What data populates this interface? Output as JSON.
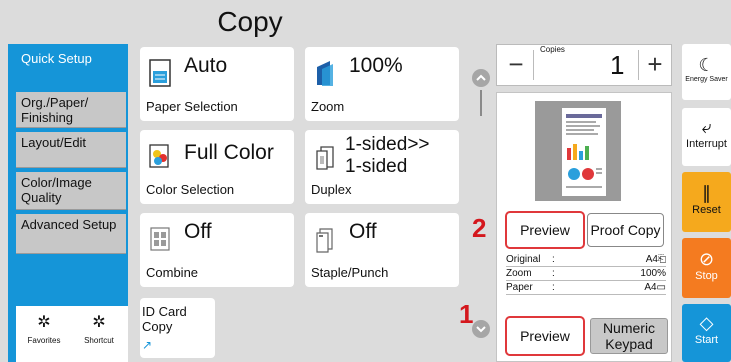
{
  "title": "Copy",
  "sidebar": {
    "items": [
      {
        "label": "Quick Setup"
      },
      {
        "label": "Org./Paper/ Finishing"
      },
      {
        "label": "Layout/Edit"
      },
      {
        "label": "Color/Image Quality"
      },
      {
        "label": "Advanced Setup"
      }
    ],
    "favorites_label": "Favorites",
    "shortcut_label": "Shortcut"
  },
  "tiles": [
    {
      "value": "Auto",
      "label": "Paper Selection",
      "icon": "paper-icon"
    },
    {
      "value": "100%",
      "label": "Zoom",
      "icon": "zoom-icon"
    },
    {
      "value": "Full Color",
      "label": "Color Selection",
      "icon": "color-icon"
    },
    {
      "value": "1-sided>>\n1-sided",
      "label": "Duplex",
      "icon": "duplex-icon"
    },
    {
      "value": "Off",
      "label": "Combine",
      "icon": "combine-icon"
    },
    {
      "value": "Off",
      "label": "Staple/Punch",
      "icon": "staple-icon"
    }
  ],
  "id_card": {
    "label": "ID Card\nCopy"
  },
  "copies": {
    "label": "Copies",
    "value": "1",
    "minus": "−",
    "plus": "+"
  },
  "preview_panel": {
    "preview_button": "Preview",
    "proof_copy_button": "Proof Copy",
    "info": [
      {
        "key": "Original",
        "sep": ":",
        "value": "A4⎗"
      },
      {
        "key": "Zoom",
        "sep": ":",
        "value": "100%"
      },
      {
        "key": "Paper",
        "sep": ":",
        "value": "A4▭"
      }
    ]
  },
  "bottom": {
    "preview_button": "Preview",
    "numeric_keypad": "Numeric\nKeypad"
  },
  "callouts": {
    "one": "1",
    "two": "2"
  },
  "right_buttons": {
    "energy_saver": "Energy Saver",
    "interrupt": "Interrupt",
    "reset": "Reset",
    "stop": "Stop",
    "start": "Start"
  },
  "colors": {
    "sidebar": "#1595d8",
    "reset": "#f5a91d",
    "stop": "#f47b20",
    "start": "#1595d8",
    "highlight": "#e0383b"
  }
}
